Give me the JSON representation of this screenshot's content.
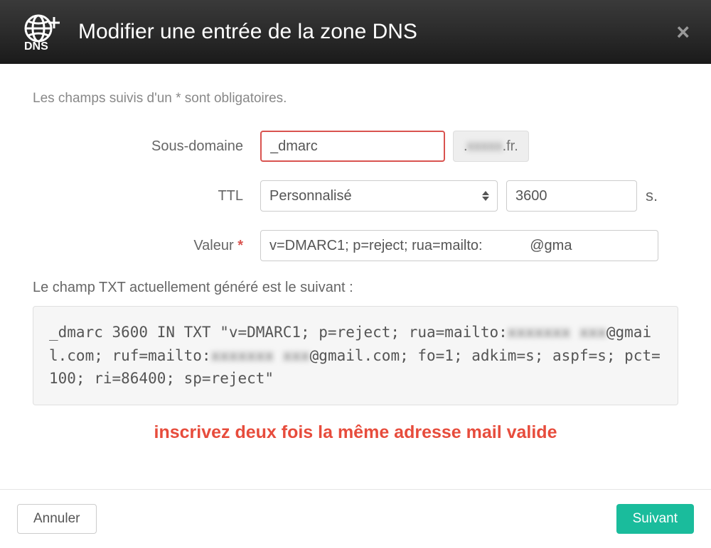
{
  "header": {
    "title": "Modifier une entrée de la zone DNS"
  },
  "form": {
    "help_text": "Les champs suivis d'un * sont obligatoires.",
    "subdomain_label": "Sous-domaine",
    "subdomain_value": "_dmarc",
    "domain_suffix_prefix": ".",
    "domain_suffix_blurred": "xxxxx",
    "domain_suffix_tld": ".fr.",
    "ttl_label": "TTL",
    "ttl_select_value": "Personnalisé",
    "ttl_num_value": "3600",
    "ttl_unit": "s.",
    "value_label": "Valeur",
    "value_input": "v=DMARC1; p=reject; rua=mailto:            @gma",
    "generated_label": "Le champ TXT actuellement généré est le suivant :",
    "generated_prefix": "_dmarc 3600 IN TXT \"v=DMARC1; p=reject; rua=mailto:",
    "generated_blur1": "xxxxxxx xxx",
    "generated_mid1": "@gmail.com; ruf=mailto:",
    "generated_blur2": "xxxxxxx xxx",
    "generated_suffix": "@gmail.com; fo=1; adkim=s; aspf=s; pct=100; ri=86400; sp=reject\"",
    "note": "inscrivez deux fois la même adresse mail valide"
  },
  "footer": {
    "cancel": "Annuler",
    "next": "Suivant"
  }
}
